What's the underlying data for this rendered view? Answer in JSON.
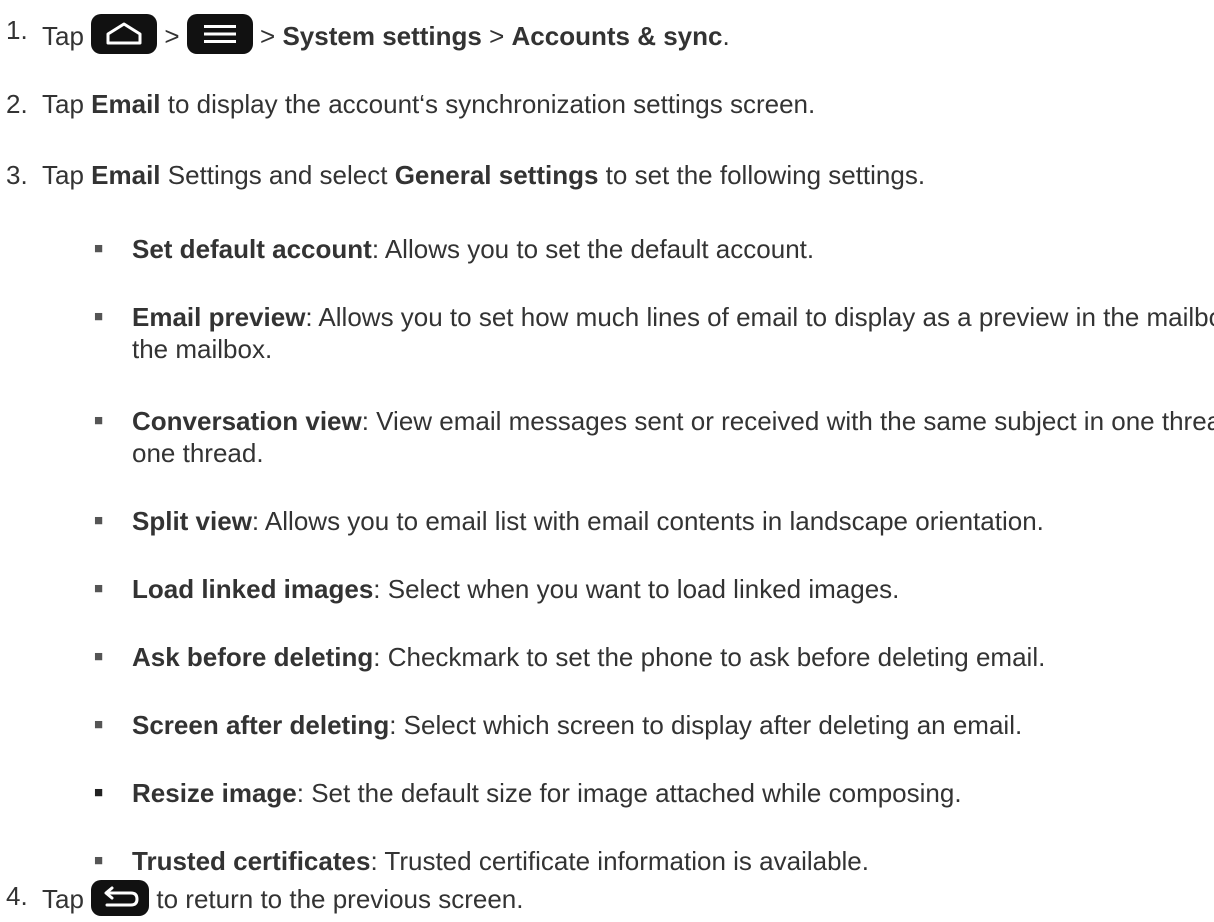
{
  "steps": [
    {
      "number": "1.",
      "tap": "Tap",
      "sep1": ">",
      "sep2": ">",
      "sep3": ">",
      "item1": "System settings",
      "item2": "Accounts & sync",
      "end": ".",
      "icons": [
        "home-key",
        "menu-key"
      ]
    },
    {
      "number": "2.",
      "before": "Tap",
      "bold": "Email",
      "after": "to display the account‘s synchronization settings screen."
    },
    {
      "number": "3.",
      "before": "Tap",
      "bold1": "Email",
      "middle": "Settings and select",
      "bold2": "General settings",
      "after": "to set the following settings."
    },
    {
      "number": "4.",
      "before": "Tap",
      "after": "to return to the previous screen.",
      "icons": [
        "back-key"
      ]
    }
  ],
  "settings": [
    {
      "term": "Set default account",
      "desc": ": Allows you to set the default account."
    },
    {
      "term": "Email preview",
      "desc": ": Allows you to set how much lines of email to display as a preview in the mailbox."
    },
    {
      "term": "Conversation view",
      "desc": ": View email messages sent or received with the same subject in one thread."
    },
    {
      "term": "Split view",
      "desc": ": Allows you to email list with email contents in landscape orientation."
    },
    {
      "term": "Load linked images",
      "desc": ": Select when you want to load linked images."
    },
    {
      "term": "Ask before deleting",
      "desc": ": Checkmark to set the phone to ask before deleting email."
    },
    {
      "term": "Screen after deleting",
      "desc": ": Select which screen to display after deleting an email."
    },
    {
      "term": "Resize image",
      "desc": ": Set the default size for image attached while composing."
    },
    {
      "term": "Trusted certificates",
      "desc": ": Trusted certificate information is available."
    }
  ],
  "bullet_glyph": "■",
  "colors": {
    "text": "#333333",
    "key_bg": "#111111",
    "key_fg": "#ffffff"
  }
}
